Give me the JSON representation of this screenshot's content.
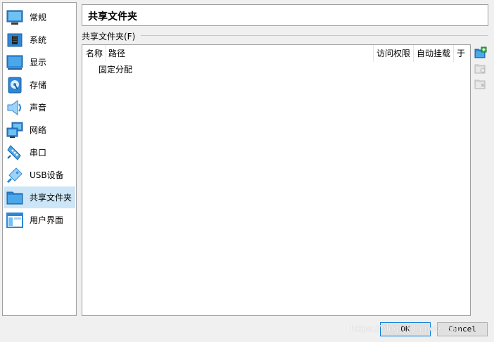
{
  "sidebar": {
    "items": [
      {
        "label": "常规",
        "icon": "general-monitor-icon"
      },
      {
        "label": "系统",
        "icon": "system-chip-icon"
      },
      {
        "label": "显示",
        "icon": "display-monitor-icon"
      },
      {
        "label": "存储",
        "icon": "storage-disk-icon"
      },
      {
        "label": "声音",
        "icon": "audio-speaker-icon"
      },
      {
        "label": "网络",
        "icon": "network-icon"
      },
      {
        "label": "串口",
        "icon": "serial-port-icon"
      },
      {
        "label": "USB设备",
        "icon": "usb-icon"
      },
      {
        "label": "共享文件夹",
        "icon": "shared-folder-icon",
        "selected": true
      },
      {
        "label": "用户界面",
        "icon": "user-interface-icon"
      }
    ]
  },
  "header": {
    "title": "共享文件夹"
  },
  "shared_folders": {
    "group_label": "共享文件夹(F)",
    "columns": [
      "名称",
      "路径",
      "访问权限",
      "自动挂载",
      "于"
    ],
    "rows": [
      "固定分配"
    ]
  },
  "toolbar": {
    "buttons": [
      {
        "icon": "add-shared-folder-icon",
        "enabled": true
      },
      {
        "icon": "edit-shared-folder-icon",
        "enabled": false
      },
      {
        "icon": "remove-shared-folder-icon",
        "enabled": false
      }
    ]
  },
  "buttons": {
    "ok": "OK",
    "cancel": "Cancel"
  },
  "watermark": "https://blog.csdn.net/...sib",
  "colors": {
    "selection": "#cde6f7",
    "accent": "#0078d7",
    "icon_blue": "#1e8fd8"
  }
}
